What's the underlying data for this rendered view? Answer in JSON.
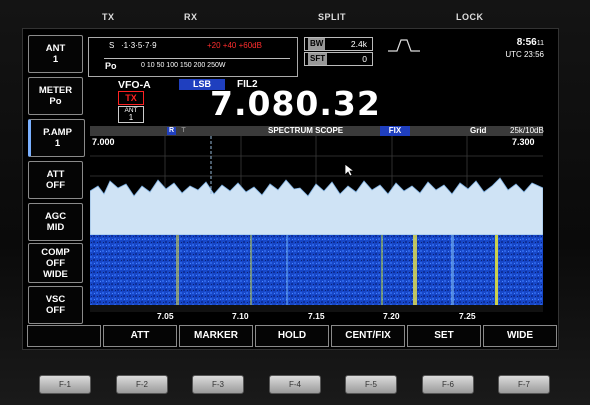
{
  "panel_labels": [
    "TX",
    "RX",
    "SPLIT",
    "LOCK"
  ],
  "side_buttons": [
    {
      "title": "ANT",
      "lines": [
        "1"
      ]
    },
    {
      "title": "METER",
      "lines": [
        "Po"
      ]
    },
    {
      "title": "P.AMP",
      "lines": [
        "1"
      ]
    },
    {
      "title": "ATT",
      "lines": [
        "OFF"
      ]
    },
    {
      "title": "AGC",
      "lines": [
        "MID"
      ]
    },
    {
      "title": "COMP",
      "lines": [
        "OFF",
        "WIDE"
      ]
    },
    {
      "title": "VSC",
      "lines": [
        "OFF"
      ]
    }
  ],
  "meter": {
    "s_label": "S",
    "s_scale": "·1·3·5·7·9",
    "s_plus": "+20 +40 +60dB",
    "po_label": "Po",
    "po_scale": "0  10      50       100 150  200  250W"
  },
  "bw": {
    "label": "BW",
    "value": "2.4k"
  },
  "sft": {
    "label": "SFT",
    "value": "0"
  },
  "clock": {
    "time": "8:56",
    "seconds": "11",
    "utc": "UTC 23:56"
  },
  "vfo": {
    "name": "VFO-A",
    "mode": "LSB",
    "filter": "FIL2",
    "tx": "TX",
    "ant_label": "ANT",
    "ant_value": "1"
  },
  "frequency": "7.080.32",
  "scope": {
    "title": "SPECTRUM SCOPE",
    "mode": "FIX",
    "grid_label": "Grid",
    "span": "25k/10dB",
    "marker_r": "R",
    "marker_t": "T",
    "left_freq": "7.000",
    "right_freq": "7.300",
    "ticks": [
      "7.05",
      "7.10",
      "7.15",
      "7.20",
      "7.25"
    ]
  },
  "menu": [
    "",
    "ATT",
    "MARKER",
    "HOLD",
    "CENT/FIX",
    "SET",
    "WIDE"
  ],
  "hw_keys": [
    "F-1",
    "F-2",
    "F-3",
    "F-4",
    "F-5",
    "F-6",
    "F-7"
  ],
  "colors": {
    "accent": "#1f3fbf",
    "tx_red": "#ff2d2d",
    "waterfall": "#1a4fd0"
  }
}
